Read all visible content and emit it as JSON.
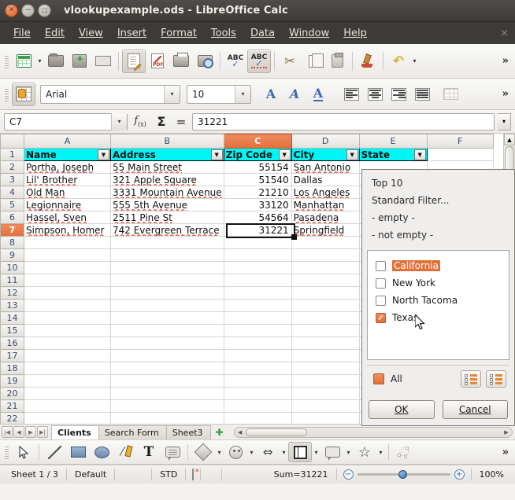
{
  "window": {
    "title": "vlookupexample.ods - LibreOffice Calc",
    "close_glyph": "✕",
    "minimize_glyph": "−",
    "maximize_glyph": "□",
    "menu_close_glyph": "×"
  },
  "menubar": {
    "items": [
      {
        "label": "File",
        "accel": "F"
      },
      {
        "label": "Edit",
        "accel": "E"
      },
      {
        "label": "View",
        "accel": "V"
      },
      {
        "label": "Insert",
        "accel": "I"
      },
      {
        "label": "Format",
        "accel": "o"
      },
      {
        "label": "Tools",
        "accel": "T"
      },
      {
        "label": "Data",
        "accel": "D"
      },
      {
        "label": "Window",
        "accel": "W"
      },
      {
        "label": "Help",
        "accel": "H"
      }
    ]
  },
  "standard_toolbar": {
    "overflow_glyph": "»",
    "dropdown_glyph": "▾",
    "buttons": [
      {
        "name": "new-document",
        "tooltip": "New"
      },
      {
        "name": "open-document",
        "tooltip": "Open"
      },
      {
        "name": "save-document",
        "tooltip": "Save"
      },
      {
        "name": "email-document",
        "tooltip": "E-mail"
      },
      {
        "name": "edit-mode",
        "tooltip": "Edit Mode"
      },
      {
        "name": "export-pdf",
        "tooltip": "Export as PDF"
      },
      {
        "name": "print-file",
        "tooltip": "Print File Directly"
      },
      {
        "name": "print-preview",
        "tooltip": "Print Preview"
      },
      {
        "name": "spelling",
        "tooltip": "Spelling and Grammar"
      },
      {
        "name": "autospellcheck",
        "tooltip": "AutoSpellcheck"
      },
      {
        "name": "cut",
        "tooltip": "Cut"
      },
      {
        "name": "copy",
        "tooltip": "Copy"
      },
      {
        "name": "paste",
        "tooltip": "Paste"
      },
      {
        "name": "clone-formatting",
        "tooltip": "Clone Formatting"
      },
      {
        "name": "undo",
        "tooltip": "Undo"
      }
    ]
  },
  "format_toolbar": {
    "font_name": "Arial",
    "font_size": "10",
    "overflow_glyph": "»",
    "dropdown_glyph": "▾",
    "bold_label": "A",
    "italic_label": "A",
    "underline_label": "A"
  },
  "formula_bar": {
    "name_box": "C7",
    "function_wizard": "f(x)",
    "sum_glyph": "Σ",
    "formula_glyph": "=",
    "input_line": "31221",
    "expand_glyph": "▾"
  },
  "sheet": {
    "columns": [
      "A",
      "B",
      "C",
      "D",
      "E",
      "F"
    ],
    "selected_column": "C",
    "selected_row": 7,
    "active_cell": "C7",
    "header_row_index": 1,
    "headers": [
      "Name",
      "Address",
      "Zip Code",
      "City",
      "State"
    ],
    "rows": [
      {
        "n": 2,
        "name": "Portha, Joseph",
        "address": "55 Main Street",
        "zip": "55154",
        "city": "San Antonio"
      },
      {
        "n": 3,
        "name": "Lil' Brother",
        "address": "321 Apple Square",
        "zip": "51540",
        "city": "Dallas"
      },
      {
        "n": 4,
        "name": "Old Man",
        "address": "3331 Mountain Avenue",
        "zip": "21210",
        "city": "Los Angeles"
      },
      {
        "n": 5,
        "name": "Legionnaire",
        "address": "555 5th Avenue",
        "zip": "33120",
        "city": "Manhattan"
      },
      {
        "n": 6,
        "name": "Hassel, Sven",
        "address": "2511 Pine St",
        "zip": "54564",
        "city": "Pasadena"
      },
      {
        "n": 7,
        "name": "Simpson, Homer",
        "address": "742 Evergreen Terrace",
        "zip": "31221",
        "city": "Springfield"
      }
    ],
    "empty_rows": [
      8,
      9,
      10,
      11,
      12,
      13,
      14,
      15,
      16,
      17,
      18,
      19,
      20,
      21,
      22
    ],
    "filter_arrow_glyph": "▼",
    "header_bg": "#00f5f5",
    "selection_color": "#e2703a"
  },
  "autofilter": {
    "menu_items": [
      "Top 10",
      "Standard Filter...",
      "- empty -",
      "- not empty -"
    ],
    "entries": [
      {
        "label": "California",
        "checked": false,
        "highlighted": true
      },
      {
        "label": "New York",
        "checked": false,
        "highlighted": false
      },
      {
        "label": "North Tacoma",
        "checked": false,
        "highlighted": false
      },
      {
        "label": "Texas",
        "checked": true,
        "highlighted": false
      }
    ],
    "all_label": "All",
    "show_all_tooltip": "Show all",
    "hide_all_tooltip": "Hide only the current item",
    "ok_label": "OK",
    "ok_accel": "O",
    "cancel_label": "Cancel",
    "cancel_accel": "C"
  },
  "sheet_tabs": {
    "first_glyph": "⏮",
    "prev_glyph": "◀",
    "next_glyph": "▶",
    "last_glyph": "⏭",
    "tabs": [
      {
        "label": "Clients",
        "active": true
      },
      {
        "label": "Search Form",
        "active": false
      },
      {
        "label": "Sheet3",
        "active": false
      }
    ],
    "add_glyph": "✚",
    "left_arrow": "◀",
    "right_arrow": "▶"
  },
  "drawing_toolbar": {
    "overflow_glyph": "»",
    "dropdown_glyph": "▾",
    "tools": [
      {
        "name": "select-tool"
      },
      {
        "name": "line-tool"
      },
      {
        "name": "rectangle-tool"
      },
      {
        "name": "ellipse-tool"
      },
      {
        "name": "freeform-line-tool"
      },
      {
        "name": "text-box-tool"
      },
      {
        "name": "callout-tool"
      },
      {
        "name": "basic-shapes-tool"
      },
      {
        "name": "symbol-shapes-tool"
      },
      {
        "name": "block-arrows-tool"
      },
      {
        "name": "flowchart-tool"
      },
      {
        "name": "callout-shapes-tool"
      },
      {
        "name": "stars-tool"
      },
      {
        "name": "points-tool"
      }
    ]
  },
  "status_bar": {
    "sheet_position": "Sheet 1 / 3",
    "page_style": "Default",
    "selection_mode": "STD",
    "document_modified": "modified-icon",
    "sum": "Sum=31221",
    "zoom_out_glyph": "−",
    "zoom_in_glyph": "+",
    "zoom_level": "100%"
  }
}
